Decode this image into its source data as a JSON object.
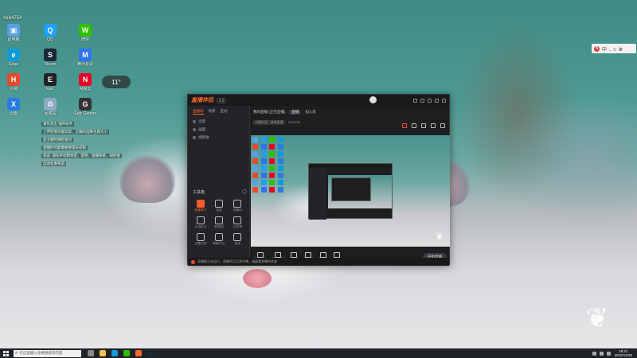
{
  "desktop": {
    "user_id": "4164754",
    "weather": "11°",
    "notifications": [
      "请先退出 插件助手",
      "上传检测功能异常，正确的选择主题大小",
      "是主题时请检查对",
      "直播时可能需要管理员权限",
      "说说: 请先手动到本后，是经，直播系统，知检查",
      "自动化发布前"
    ],
    "icons": [
      {
        "label": "此电脑",
        "color": "#5aa0e6",
        "glyph": "▣"
      },
      {
        "label": "QQ",
        "color": "#1fa0ff",
        "glyph": "Q"
      },
      {
        "label": "微信",
        "color": "#2dc100",
        "glyph": "W"
      },
      {
        "label": "Edge",
        "color": "#0f9bd8",
        "glyph": "e"
      },
      {
        "label": "Steam",
        "color": "#1b2838",
        "glyph": "S"
      },
      {
        "label": "腾讯会议",
        "color": "#2d74f0",
        "glyph": "M"
      },
      {
        "label": "火绒",
        "color": "#e64a2e",
        "glyph": "H"
      },
      {
        "label": "Epic",
        "color": "#222222",
        "glyph": "E"
      },
      {
        "label": "网易云",
        "color": "#e60026",
        "glyph": "N"
      },
      {
        "label": "迅雷",
        "color": "#2a7ae4",
        "glyph": "X"
      },
      {
        "label": "回收站",
        "color": "#8fa9c3",
        "glyph": "♻"
      },
      {
        "label": "Epic Games",
        "color": "#333333",
        "glyph": "G"
      }
    ]
  },
  "tray_top": {
    "label": "中 ·, ☺ ⚙"
  },
  "app": {
    "title": "直播伴侣",
    "version": "5.0",
    "sidebar_tabs": [
      "直播间",
      "场景",
      "互动"
    ],
    "sidebar_rows": [
      "全景",
      "画面",
      "视频源"
    ],
    "tools_label": "工具箱",
    "tools": [
      {
        "label": "直播助手",
        "active": true
      },
      {
        "label": "连麦",
        "active": false
      },
      {
        "label": "直播间",
        "active": false
      },
      {
        "label": "互动玩法",
        "active": false
      },
      {
        "label": "粉丝团",
        "active": false
      },
      {
        "label": "心愿单",
        "active": false
      },
      {
        "label": "主播任务",
        "active": false
      },
      {
        "label": "数据中心",
        "active": false
      },
      {
        "label": "更多",
        "active": false
      }
    ],
    "main_title": "我的直播 (正在直播)",
    "main_tag": "直播",
    "main_tag2": "加入房",
    "sub_pill": "主播标签 · 游戏直播",
    "sub_count": "4164754",
    "controls": [
      "画面截图",
      "直播标签",
      "多机位",
      "画中画",
      "麦克风",
      "声音"
    ],
    "start_button": "开始直播",
    "footer": "直播姬正在运行，直播间可正常开播，请留意直播间状态"
  },
  "taskbar": {
    "search_placeholder": "在这里输入你要搜索的内容",
    "clock_time": "19:21",
    "clock_date": "2022/12/26"
  }
}
